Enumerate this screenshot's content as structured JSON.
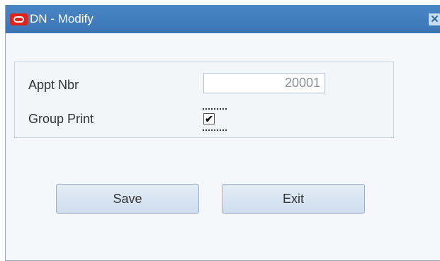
{
  "window": {
    "title": "DN - Modify",
    "close_symbol": "✕"
  },
  "form": {
    "appt_nbr_label": "Appt Nbr",
    "appt_nbr_value": "20001",
    "group_print_label": "Group Print",
    "group_print_checked": true,
    "check_mark": "✔"
  },
  "buttons": {
    "save_label": "Save",
    "exit_label": "Exit"
  },
  "colors": {
    "titlebar": "#3a7dc0",
    "logo": "#e2231a",
    "button_bg": "#d9e6f3"
  }
}
